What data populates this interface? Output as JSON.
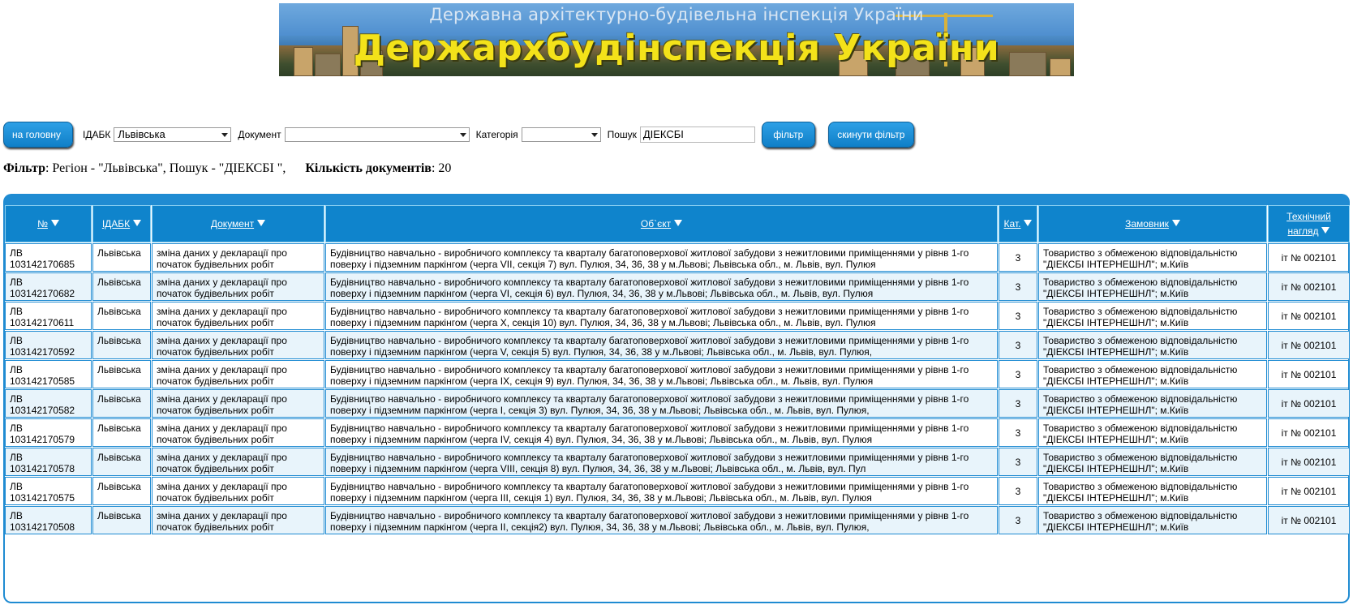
{
  "banner": {
    "subtitle": "Державна архітектурно-будівельна інспекція України",
    "title": "Держархбудінспекція України"
  },
  "toolbar": {
    "home_button": "на головну",
    "idabk_label": "ІДАБК",
    "idabk_value": "Львівська",
    "document_label": "Документ",
    "document_value": "",
    "category_label": "Категорія",
    "category_value": "",
    "search_label": "Пошук",
    "search_value": "ДІЕКСБІ",
    "filter_button": "фільтр",
    "reset_button": "скинути фільтр"
  },
  "filter_info": {
    "filter_label": "Фільтр",
    "filter_text": ": Регіон - \"Львівська\", Пошук - \"ДІЕКСБІ \",",
    "count_label": "Кількість документів",
    "count_text": ": 20"
  },
  "table": {
    "headers": {
      "num": "№",
      "idabk": "ІДАБК",
      "document": "Документ",
      "object": "Об`єкт",
      "cat": "Кат.",
      "customer": "Замовник",
      "tech_line1": "Технічний",
      "tech_line2": "нагляд"
    },
    "rows": [
      {
        "num1": "ЛВ",
        "num2": "103142170685",
        "idabk": "Львівська",
        "doc": "зміна даних у декларації про початок будівельних робіт",
        "object": "Будівництво навчально - виробничого комплексу та кварталу багатоповерхової житлової забудови з нежитловими приміщеннями у рівнв 1-го поверху і підземним паркінгом (черга VII, секція 7) вул. Пулюя, 34, 36, 38 у м.Львові; Львівська обл., м. Львів, вул. Пулюя",
        "cat": "3",
        "customer": "Товариство з обмеженою відповідальністю \"ДІЕКСБІ ІНТЕРНЕШНЛ\"; м.Київ",
        "tech": "іт № 002101"
      },
      {
        "num1": "ЛВ",
        "num2": "103142170682",
        "idabk": "Львівська",
        "doc": "зміна даних у декларації про початок будівельних робіт",
        "object": "Будівництво навчально - виробничого комплексу та кварталу багатоповерхової житлової забудови з нежитловими приміщеннями у рівнв 1-го поверху і підземним паркінгом (черга VI, секція 6) вул. Пулюя, 34, 36, 38 у м.Львові; Львівська обл., м. Львів, вул. Пулюя",
        "cat": "3",
        "customer": "Товариство з обмеженою відповідальністю \"ДІЕКСБІ ІНТЕРНЕШНЛ\"; м.Київ",
        "tech": "іт № 002101"
      },
      {
        "num1": "ЛВ",
        "num2": "103142170611",
        "idabk": "Львівська",
        "doc": "зміна даних у декларації про початок будівельних робіт",
        "object": "Будівництво навчально - виробничого комплексу та кварталу багатоповерхової житлової забудови з нежитловими приміщеннями у рівнв 1-го поверху і підземним паркінгом (черга X, секція 10) вул. Пулюя, 34, 36, 38 у м.Львові; Львівська обл., м. Львів, вул. Пулюя",
        "cat": "3",
        "customer": "Товариство з обмеженою відповідальністю \"ДІЕКСБІ ІНТЕРНЕШНЛ\"; м.Київ",
        "tech": "іт № 002101"
      },
      {
        "num1": "ЛВ",
        "num2": "103142170592",
        "idabk": "Львівська",
        "doc": "зміна даних у декларації про початок будівельних робіт",
        "object": "Будівництво навчально - виробничого комплексу та кварталу багатоповерхової житлової забудови з нежитловими приміщеннями у рівнв 1-го поверху і підземним паркінгом (черга V, секція 5) вул. Пулюя, 34, 36, 38 у м.Львові; Львівська обл., м. Львів, вул. Пулюя,",
        "cat": "3",
        "customer": "Товариство з обмеженою відповідальністю \"ДІЕКСБІ ІНТЕРНЕШНЛ\"; м.Київ",
        "tech": "іт № 002101"
      },
      {
        "num1": "ЛВ",
        "num2": "103142170585",
        "idabk": "Львівська",
        "doc": "зміна даних у декларації про початок будівельних робіт",
        "object": "Будівництво навчально - виробничого комплексу та кварталу багатоповерхової житлової забудови з нежитловими приміщеннями у рівнв 1-го поверху і підземним паркінгом (черга IX, секція 9) вул. Пулюя, 34, 36, 38 у м.Львові; Львівська обл., м. Львів, вул. Пулюя",
        "cat": "3",
        "customer": "Товариство з обмеженою відповідальністю \"ДІЕКСБІ ІНТЕРНЕШНЛ\"; м.Київ",
        "tech": "іт № 002101"
      },
      {
        "num1": "ЛВ",
        "num2": "103142170582",
        "idabk": "Львівська",
        "doc": "зміна даних у декларації про початок будівельних робіт",
        "object": "Будівництво навчально - виробничого комплексу та кварталу багатоповерхової житлової забудови з нежитловими приміщеннями у рівнв 1-го поверху і підземним паркінгом (черга I, секція 3) вул. Пулюя, 34, 36, 38 у м.Львові; Львівська обл., м. Львів, вул. Пулюя,",
        "cat": "3",
        "customer": "Товариство з обмеженою відповідальністю \"ДІЕКСБІ ІНТЕРНЕШНЛ\"; м.Київ",
        "tech": "іт № 002101"
      },
      {
        "num1": "ЛВ",
        "num2": "103142170579",
        "idabk": "Львівська",
        "doc": "зміна даних у декларації про початок будівельних робіт",
        "object": "Будівництво навчально - виробничого комплексу та кварталу багатоповерхової житлової забудови з нежитловими приміщеннями у рівнв 1-го поверху і підземним паркінгом (черга IV, секція 4) вул. Пулюя, 34, 36, 38 у м.Львові; Львівська обл., м. Львів, вул. Пулюя",
        "cat": "3",
        "customer": "Товариство з обмеженою відповідальністю \"ДІЕКСБІ ІНТЕРНЕШНЛ\"; м.Київ",
        "tech": "іт № 002101"
      },
      {
        "num1": "ЛВ",
        "num2": "103142170578",
        "idabk": "Львівська",
        "doc": "зміна даних у декларації про початок будівельних робіт",
        "object": "Будівництво навчально - виробничого комплексу та кварталу багатоповерхової житлової забудови з нежитловими приміщеннями у рівнв 1-го поверху і підземним паркінгом (черга VIII, секція 8) вул. Пулюя, 34, 36, 38 у м.Львові; Львівська обл., м. Львів, вул. Пул",
        "cat": "3",
        "customer": "Товариство з обмеженою відповідальністю \"ДІЕКСБІ ІНТЕРНЕШНЛ\"; м.Київ",
        "tech": "іт № 002101"
      },
      {
        "num1": "ЛВ",
        "num2": "103142170575",
        "idabk": "Львівська",
        "doc": "зміна даних у декларації про початок будівельних робіт",
        "object": "Будівництво навчально - виробничого комплексу та кварталу багатоповерхової житлової забудови з нежитловими приміщеннями у рівнв 1-го поверху і підземним паркінгом (черга III, секція 1) вул. Пулюя, 34, 36, 38 у м.Львові; Львівська обл., м. Львів, вул. Пулюя",
        "cat": "3",
        "customer": "Товариство з обмеженою відповідальністю \"ДІЕКСБІ ІНТЕРНЕШНЛ\"; м.Київ",
        "tech": "іт № 002101"
      },
      {
        "num1": "ЛВ",
        "num2": "103142170508",
        "idabk": "Львівська",
        "doc": "зміна даних у декларації про початок будівельних робіт",
        "object": "Будівництво навчально - виробничого комплексу та кварталу багатоповерхової житлової забудови з нежитловими приміщеннями у рівнв 1-го поверху і підземним паркінгом (черга II, секція2) вул. Пулюя, 34, 36, 38 у м.Львові; Львівська обл., м. Львів, вул. Пулюя,",
        "cat": "3",
        "customer": "Товариство з обмеженою відповідальністю \"ДІЕКСБІ ІНТЕРНЕШНЛ\"; м.Київ",
        "tech": "іт № 002101"
      }
    ]
  },
  "colors": {
    "accent": "#0f84cc",
    "row_alt": "#e8f4fb",
    "banner_title": "#f3e21a"
  }
}
